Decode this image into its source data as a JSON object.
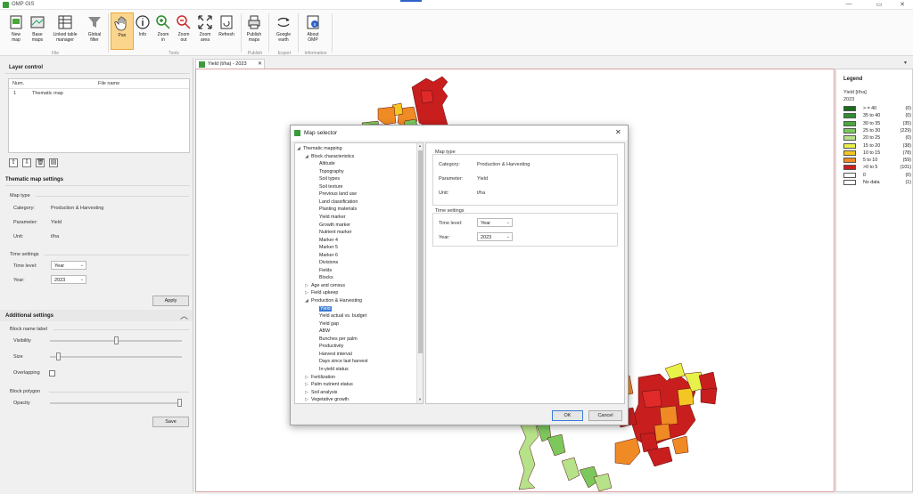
{
  "window": {
    "title": "OMP GIS",
    "min_label": "—",
    "max_label": "▭",
    "close_label": "✕"
  },
  "ribbon": {
    "buttons": [
      {
        "label": "New\nmap",
        "icon": "new-map-icon"
      },
      {
        "label": "Base\nmaps",
        "icon": "base-maps-icon"
      },
      {
        "label": "Linked table\nmanager",
        "icon": "linked-table-icon"
      },
      {
        "label": "Global\nfilter",
        "icon": "filter-icon"
      },
      {
        "label": "Pan",
        "icon": "hand-icon"
      },
      {
        "label": "Info",
        "icon": "info-icon"
      },
      {
        "label": "Zoom\nin",
        "icon": "zoom-in-icon"
      },
      {
        "label": "Zoom\nout",
        "icon": "zoom-out-icon"
      },
      {
        "label": "Zoom\narea",
        "icon": "zoom-area-icon"
      },
      {
        "label": "Refresh",
        "icon": "refresh-icon"
      },
      {
        "label": "Publish\nmaps",
        "icon": "publish-icon"
      },
      {
        "label": "Google\nearth",
        "icon": "google-earth-icon"
      },
      {
        "label": "About\nOMP",
        "icon": "about-icon"
      }
    ],
    "groups": {
      "file": "File",
      "tools": "Tools",
      "publish": "Publish",
      "export": "Export",
      "information": "Information"
    }
  },
  "layer_control": {
    "title": "Layer control",
    "col_num": "Num.",
    "col_file": "File name",
    "rows": [
      {
        "num": "1",
        "name": "Thematic map"
      }
    ]
  },
  "thematic_settings": {
    "title": "Thematic map settings",
    "map_type_title": "Map type",
    "category_label": "Category:",
    "category_value": "Production & Harvesting",
    "parameter_label": "Parameter:",
    "parameter_value": "Yield",
    "unit_label": "Unit:",
    "unit_value": "t/ha",
    "time_title": "Time settings",
    "time_level_label": "Time level:",
    "time_level_value": "Year",
    "year_label": "Year:",
    "year_value": "2023",
    "apply": "Apply"
  },
  "additional_settings": {
    "title": "Additional settings",
    "block_label_title": "Block name label",
    "visibility_label": "Visibility",
    "visibility_level": 0.5,
    "size_label": "Size",
    "size_level": 0.05,
    "overlapping_label": "Overlapping",
    "block_polygon_title": "Block polygon",
    "opacity_label": "Opacity",
    "opacity_level": 1.0,
    "save": "Save"
  },
  "map_tab": {
    "label": "Yield (t/ha) - 2023"
  },
  "legend": {
    "title": "Legend",
    "subtitle1": "Yield [t/ha]",
    "subtitle2": "2023",
    "items": [
      {
        "color": "#1a6b1a",
        "label": "> = 40",
        "count": "(0)"
      },
      {
        "color": "#2f8f2f",
        "label": "35 to 40",
        "count": "(0)"
      },
      {
        "color": "#4aa83a",
        "label": "30 to 35",
        "count": "(35)"
      },
      {
        "color": "#7cc85c",
        "label": "25 to 30",
        "count": "(229)"
      },
      {
        "color": "#b6e28a",
        "label": "20 to 25",
        "count": "(0)"
      },
      {
        "color": "#e8f04a",
        "label": "15 to 20",
        "count": "(38)"
      },
      {
        "color": "#f3c623",
        "label": "10 to 15",
        "count": "(78)"
      },
      {
        "color": "#f08a24",
        "label": "5 to 10",
        "count": "(59)"
      },
      {
        "color": "#c81e1e",
        "label": ">0 to 5",
        "count": "(101)"
      },
      {
        "color": "#ffffff",
        "label": "0",
        "count": "(0)"
      },
      {
        "color": "#ffffff",
        "label": "No data",
        "count": "(1)"
      }
    ]
  },
  "dialog": {
    "title": "Map selector",
    "close": "✕",
    "tree": [
      {
        "label": "Thematic mapping",
        "level": 0,
        "exp": "◢"
      },
      {
        "label": "Block characteristics",
        "level": 1,
        "exp": "◢"
      },
      {
        "label": "Altitude",
        "level": 2
      },
      {
        "label": "Topography",
        "level": 2
      },
      {
        "label": "Soil types",
        "level": 2
      },
      {
        "label": "Soil texture",
        "level": 2
      },
      {
        "label": "Previous land use",
        "level": 2
      },
      {
        "label": "Land classification",
        "level": 2
      },
      {
        "label": "Planting materials",
        "level": 2
      },
      {
        "label": "Yield marker",
        "level": 2
      },
      {
        "label": "Growth marker",
        "level": 2
      },
      {
        "label": "Nutrient marker",
        "level": 2
      },
      {
        "label": "Marker 4",
        "level": 2
      },
      {
        "label": "Marker 5",
        "level": 2
      },
      {
        "label": "Marker 6",
        "level": 2
      },
      {
        "label": "Divisions",
        "level": 2
      },
      {
        "label": "Fields",
        "level": 2
      },
      {
        "label": "Blocks",
        "level": 2
      },
      {
        "label": "Age and census",
        "level": 1,
        "exp": "▷"
      },
      {
        "label": "Field upkeep",
        "level": 1,
        "exp": "▷"
      },
      {
        "label": "Production & Harvesting",
        "level": 1,
        "exp": "◢"
      },
      {
        "label": "Yield",
        "level": 2,
        "selected": true
      },
      {
        "label": "Yield actual vs. budget",
        "level": 2
      },
      {
        "label": "Yield gap",
        "level": 2
      },
      {
        "label": "ABW",
        "level": 2
      },
      {
        "label": "Bunches per palm",
        "level": 2
      },
      {
        "label": "Productivity",
        "level": 2
      },
      {
        "label": "Harvest interval",
        "level": 2
      },
      {
        "label": "Days since last harvest",
        "level": 2
      },
      {
        "label": "In-yield status",
        "level": 2
      },
      {
        "label": "Fertilization",
        "level": 1,
        "exp": "▷"
      },
      {
        "label": "Palm nutrient status",
        "level": 1,
        "exp": "▷"
      },
      {
        "label": "Soil analysis",
        "level": 1,
        "exp": "▷"
      },
      {
        "label": "Vegetative growth",
        "level": 1,
        "exp": "▷"
      }
    ],
    "map_type_title": "Map type",
    "category_label": "Category:",
    "category_value": "Production & Harvesting",
    "parameter_label": "Parameter:",
    "parameter_value": "Yield",
    "unit_label": "Unit:",
    "unit_value": "t/ha",
    "time_title": "Time settings",
    "time_level_label": "Time level:",
    "time_level_value": "Year",
    "year_label": "Year:",
    "year_value": "2023",
    "ok": "OK",
    "cancel": "Cancel"
  }
}
